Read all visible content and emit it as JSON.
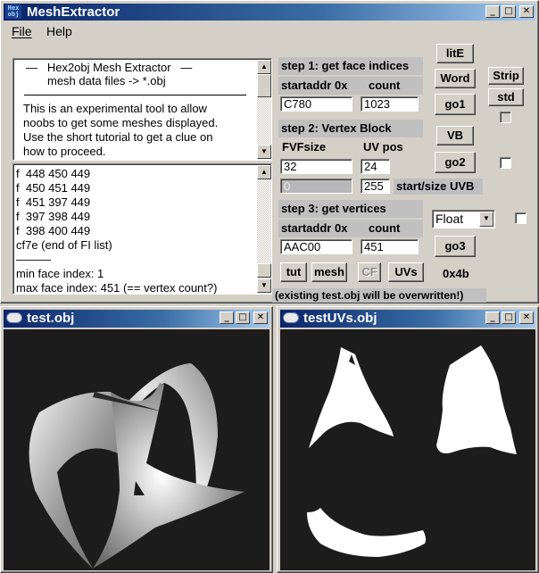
{
  "main": {
    "icon_text": "Hex obj",
    "title": "MeshExtractor",
    "menu": {
      "file": "File",
      "help": "Help"
    },
    "info": {
      "line1": "—   Hex2obj Mesh Extractor   —",
      "line2": "mesh data files -> *.obj",
      "para": [
        "This is an experimental tool to allow",
        "noobs to get some meshes displayed.",
        "Use the short tutorial to get a clue on",
        "how to proceed."
      ]
    },
    "log": {
      "lines": [
        "f  448 450 449",
        "f  450 451 449",
        "f  451 397 449",
        "f  397 398 449",
        "f  398 400 449",
        "cf7e (end of FI list)",
        "———",
        "min face index: 1",
        "max face index: 451 (== vertex count?)"
      ]
    },
    "step1": {
      "header": "step 1: get face indices",
      "col1": "startaddr 0x",
      "col2": "count",
      "start": "C780",
      "count": "1023"
    },
    "step2": {
      "header": "step 2: Vertex Block",
      "col1": "FVFsize",
      "col2": "UV pos",
      "fvf": "32",
      "uvpos": "24",
      "disabled_val": "0",
      "size": "255",
      "size_label": "start/size UVB"
    },
    "step3": {
      "header": "step 3: get vertices",
      "col1": "startaddr 0x",
      "col2": "count",
      "start": "AAC00",
      "count": "451"
    },
    "buttons": {
      "lite": "litE",
      "word": "Word",
      "go1": "go1",
      "strip": "Strip",
      "std": "std",
      "vb": "VB",
      "go2": "go2",
      "go3": "go3",
      "tut": "tut",
      "mesh": "mesh",
      "cf": "CF",
      "uvs": "UVs",
      "hex4b": "0x4b"
    },
    "format_select": "Float",
    "warning": "(existing test.obj will be overwritten!)"
  },
  "test_window": {
    "title": "test.obj"
  },
  "uvs_window": {
    "title": "testUVs.obj"
  },
  "colors": {
    "title_active": "#0a246a",
    "face": "#d4d0c8",
    "viewport_bg": "#1c1c1c"
  }
}
